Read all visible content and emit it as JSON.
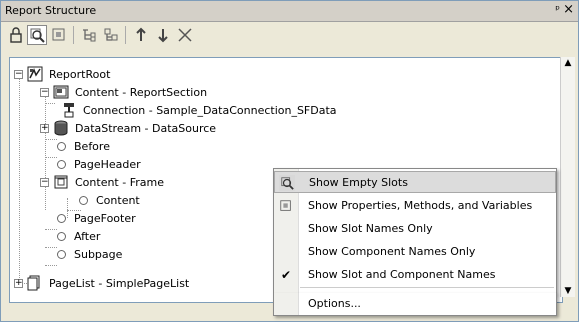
{
  "window": {
    "title": "Report Structure",
    "pin_glyph": "ᵖ",
    "close_glyph": "×"
  },
  "toolbar": {
    "buttons": [
      {
        "name": "lock-icon",
        "glyph": "🔒"
      },
      {
        "name": "show-empty-slots-icon",
        "glyph": "🔍"
      },
      {
        "name": "show-properties-icon",
        "glyph": "▣"
      },
      {
        "name": "collapse-all-icon",
        "glyph": "⇉"
      },
      {
        "name": "expand-all-icon",
        "glyph": "⇶"
      },
      {
        "name": "move-up-icon",
        "glyph": "↑"
      },
      {
        "name": "move-down-icon",
        "glyph": "↓"
      },
      {
        "name": "delete-icon",
        "glyph": "✕"
      }
    ]
  },
  "tree": {
    "nodes": [
      {
        "label": "ReportRoot",
        "icon": "report-root-icon",
        "expander": "−"
      },
      {
        "label": "Content - ReportSection",
        "icon": "report-section-icon",
        "expander": "−"
      },
      {
        "label": "Connection - Sample_DataConnection_SFData",
        "icon": "connection-icon",
        "expander": ""
      },
      {
        "label": "DataStream - DataSource",
        "icon": "datastream-icon",
        "expander": "+"
      },
      {
        "label": "Before",
        "icon": "slot-icon",
        "expander": ""
      },
      {
        "label": "PageHeader",
        "icon": "slot-icon",
        "expander": ""
      },
      {
        "label": "Content - Frame",
        "icon": "frame-icon",
        "expander": "−"
      },
      {
        "label": "Content",
        "icon": "slot-icon",
        "expander": ""
      },
      {
        "label": "PageFooter",
        "icon": "slot-icon",
        "expander": ""
      },
      {
        "label": "After",
        "icon": "slot-icon",
        "expander": ""
      },
      {
        "label": "Subpage",
        "icon": "slot-icon",
        "expander": ""
      },
      {
        "label": "PageList - SimplePageList",
        "icon": "pagelist-icon",
        "expander": "+"
      }
    ]
  },
  "context_menu": {
    "items": [
      {
        "label": "Show Empty Slots",
        "icon": "show-empty-slots-icon",
        "highlighted": true,
        "checked": false
      },
      {
        "label": "Show Properties, Methods, and Variables",
        "icon": "show-properties-icon",
        "highlighted": false,
        "checked": false
      },
      {
        "label": "Show Slot Names Only",
        "icon": "",
        "highlighted": false,
        "checked": false
      },
      {
        "label": "Show Component Names Only",
        "icon": "",
        "highlighted": false,
        "checked": false
      },
      {
        "label": "Show Slot and Component Names",
        "icon": "check-icon",
        "highlighted": false,
        "checked": true
      },
      {
        "label": "Options...",
        "icon": "",
        "highlighted": false,
        "checked": false
      }
    ]
  },
  "scrollbar": {
    "up_glyph": "▲",
    "down_glyph": "▼"
  }
}
